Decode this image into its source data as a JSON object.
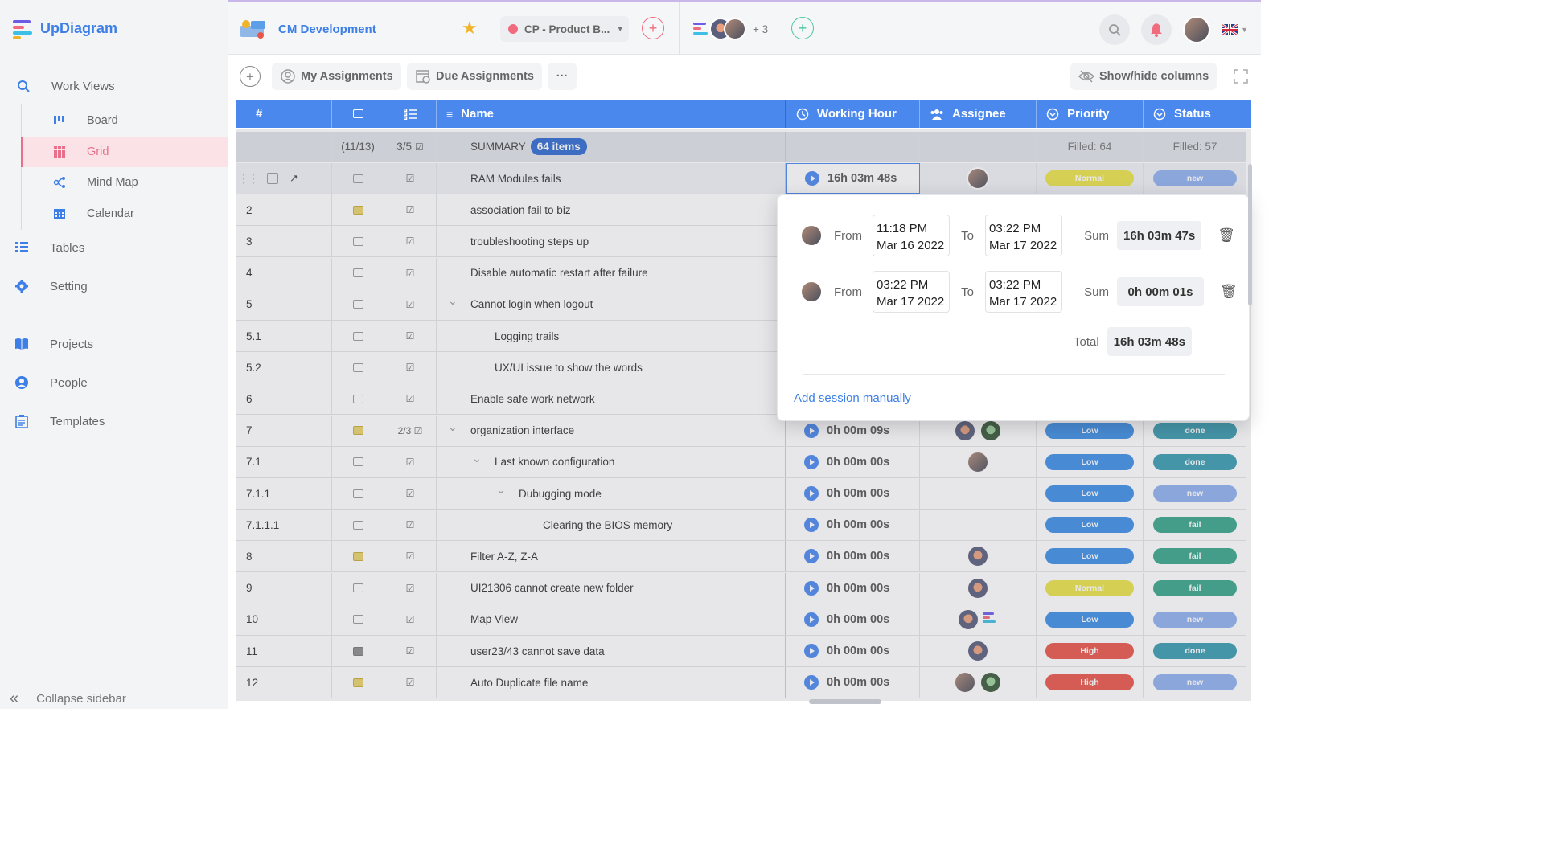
{
  "app": {
    "name": "UpDiagram"
  },
  "sidebar": {
    "work_views": "Work Views",
    "views": [
      {
        "label": "Board",
        "icon": "board-icon"
      },
      {
        "label": "Grid",
        "icon": "grid-icon",
        "active": true
      },
      {
        "label": "Mind Map",
        "icon": "mind-map-icon"
      },
      {
        "label": "Calendar",
        "icon": "calendar-icon"
      }
    ],
    "tables": "Tables",
    "setting": "Setting",
    "projects": "Projects",
    "people": "People",
    "templates": "Templates",
    "collapse": "Collapse sidebar"
  },
  "topbar": {
    "project_name": "CM Development",
    "dropdown_label": "CP - Product B...",
    "member_extra": "+ 3"
  },
  "toolbar": {
    "my_assignments": "My Assignments",
    "due_assignments": "Due Assignments",
    "more": "···",
    "show_hide": "Show/hide columns"
  },
  "grid": {
    "headers": {
      "num": "#",
      "name": "Name",
      "working_hour": "Working Hour",
      "assignee": "Assignee",
      "priority": "Priority",
      "status": "Status"
    },
    "summary": {
      "comments": "(11/13)",
      "checks": "3/5",
      "label": "SUMMARY",
      "items": "64 items",
      "priority_filled": "Filled: 64",
      "status_filled": "Filled: 57"
    },
    "rows": [
      {
        "num": "",
        "comment": "empty",
        "check": "☑",
        "name": "RAM Modules fails",
        "indent": 0,
        "wh": "16h 03m 48s",
        "assignees": [
          "photo"
        ],
        "priority": "Normal",
        "status": "new"
      },
      {
        "num": "2",
        "comment": "yellow",
        "check": "☑",
        "name": "association fail to biz",
        "indent": 0,
        "wh": "",
        "assignees": [],
        "priority": "",
        "status": ""
      },
      {
        "num": "3",
        "comment": "empty",
        "check": "☑",
        "name": "troubleshooting steps up",
        "indent": 0,
        "wh": "",
        "assignees": [],
        "priority": "",
        "status": ""
      },
      {
        "num": "4",
        "comment": "empty",
        "check": "☑",
        "name": "Disable automatic restart after failure",
        "indent": 0,
        "wh": "",
        "assignees": [],
        "priority": "",
        "status": ""
      },
      {
        "num": "5",
        "comment": "empty",
        "check": "☑",
        "name": "Cannot login when logout",
        "indent": 0,
        "caret": true,
        "wh": "",
        "assignees": [],
        "priority": "",
        "status": ""
      },
      {
        "num": "5.1",
        "comment": "empty",
        "check": "☑",
        "name": "Logging trails",
        "indent": 1,
        "wh": "",
        "assignees": [],
        "priority": "",
        "status": ""
      },
      {
        "num": "5.2",
        "comment": "empty",
        "check": "☑",
        "name": "UX/UI issue to show the words",
        "indent": 1,
        "wh": "",
        "assignees": [],
        "priority": "",
        "status": ""
      },
      {
        "num": "6",
        "comment": "empty",
        "check": "☑",
        "name": "Enable safe work network",
        "indent": 0,
        "wh": "",
        "assignees": [],
        "priority": "",
        "status": ""
      },
      {
        "num": "7",
        "comment": "yellow",
        "check": "2/3 ☑",
        "name": "organization interface",
        "indent": 0,
        "caret": true,
        "wh": "0h 00m 09s",
        "assignees": [
          "dark",
          "green"
        ],
        "priority": "Low",
        "status": "done"
      },
      {
        "num": "7.1",
        "comment": "empty",
        "check": "☑",
        "name": "Last known configuration",
        "indent": 1,
        "caret": true,
        "wh": "0h 00m 00s",
        "assignees": [
          "photo"
        ],
        "priority": "Low",
        "status": "done"
      },
      {
        "num": "7.1.1",
        "comment": "empty",
        "check": "☑",
        "name": "Dubugging mode",
        "indent": 2,
        "caret": true,
        "wh": "0h 00m 00s",
        "assignees": [],
        "priority": "Low",
        "status": "new"
      },
      {
        "num": "7.1.1.1",
        "comment": "empty",
        "check": "☑",
        "name": "Clearing the BIOS memory",
        "indent": 3,
        "wh": "0h 00m 00s",
        "assignees": [],
        "priority": "Low",
        "status": "fail"
      },
      {
        "num": "8",
        "comment": "yellow",
        "check": "☑",
        "name": "Filter A-Z, Z-A",
        "indent": 0,
        "wh": "0h 00m 00s",
        "assignees": [
          "dark"
        ],
        "priority": "Low",
        "status": "fail"
      },
      {
        "num": "9",
        "comment": "empty",
        "check": "☑",
        "name": "UI21306 cannot create new folder",
        "indent": 0,
        "wh": "0h 00m 00s",
        "assignees": [
          "dark"
        ],
        "priority": "Normal",
        "status": "fail"
      },
      {
        "num": "10",
        "comment": "empty",
        "check": "☑",
        "name": "Map View",
        "indent": 0,
        "wh": "0h 00m 00s",
        "assignees": [
          "dark",
          "logo"
        ],
        "priority": "Low",
        "status": "new"
      },
      {
        "num": "11",
        "comment": "gray",
        "check": "☑",
        "name": "user23/43 cannot save data",
        "indent": 0,
        "wh": "0h 00m 00s",
        "assignees": [
          "dark"
        ],
        "priority": "High",
        "status": "done"
      },
      {
        "num": "12",
        "comment": "yellow",
        "check": "☑",
        "name": "Auto Duplicate file name",
        "indent": 0,
        "wh": "0h 00m 00s",
        "assignees": [
          "photo",
          "green"
        ],
        "priority": "High",
        "status": "new"
      }
    ]
  },
  "colors": {
    "priority": {
      "Normal": "#e9e34a",
      "Low": "#3d8fe6",
      "High": "#e8564a"
    },
    "status": {
      "new": "#8fb0ee",
      "done": "#3a9bb0",
      "fail": "#39a58a"
    }
  },
  "popup": {
    "from_label": "From",
    "to_label": "To",
    "sum_label": "Sum",
    "total_label": "Total",
    "sessions": [
      {
        "from_time": "11:18 PM",
        "from_date": "Mar 16 2022",
        "to_time": "03:22 PM",
        "to_date": "Mar 17 2022",
        "sum": "16h 03m 47s"
      },
      {
        "from_time": "03:22 PM",
        "from_date": "Mar 17 2022",
        "to_time": "03:22 PM",
        "to_date": "Mar 17 2022",
        "sum": "0h 00m 01s"
      }
    ],
    "total": "16h 03m 48s",
    "add_session": "Add session manually"
  }
}
